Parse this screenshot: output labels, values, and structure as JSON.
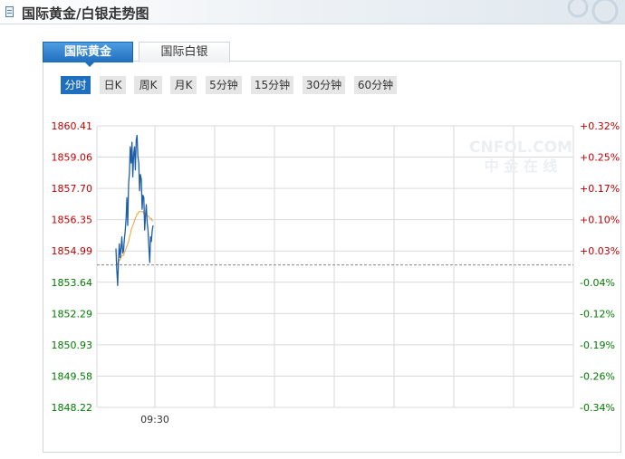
{
  "header": {
    "title": "国际黄金/白银走势图"
  },
  "tabs": [
    {
      "label": "国际黄金",
      "active": true
    },
    {
      "label": "国际白银",
      "active": false
    }
  ],
  "periods": [
    {
      "label": "分时",
      "active": true
    },
    {
      "label": "日K",
      "active": false
    },
    {
      "label": "周K",
      "active": false
    },
    {
      "label": "月K",
      "active": false
    },
    {
      "label": "5分钟",
      "active": false
    },
    {
      "label": "15分钟",
      "active": false
    },
    {
      "label": "30分钟",
      "active": false
    },
    {
      "label": "60分钟",
      "active": false
    }
  ],
  "watermark": {
    "main": "CNFOL.COM",
    "sub": "中 金 在 线"
  },
  "colors": {
    "price_line": "#1f5fa8",
    "avg_line": "#f0a030",
    "up_text": "#c00000",
    "down_text": "#007a00",
    "grid": "#d9d9d9",
    "active_tab": "#1f6fc0"
  },
  "chart_data": {
    "type": "line",
    "title": "",
    "xlabel": "",
    "ylabel": "",
    "ylim": [
      1848.22,
      1860.41
    ],
    "reference_price": 1854.39,
    "x_ticks": [
      "09:30"
    ],
    "y_ticks_left": [
      "1860.41",
      "1859.06",
      "1857.70",
      "1856.35",
      "1854.99",
      "1853.64",
      "1852.29",
      "1850.93",
      "1849.58",
      "1848.22"
    ],
    "y_ticks_right": [
      "+0.32%",
      "+0.25%",
      "+0.17%",
      "+0.10%",
      "+0.03%",
      "-0.04%",
      "-0.12%",
      "-0.19%",
      "-0.26%",
      "-0.34%"
    ],
    "series": [
      {
        "values": [
          1855.1,
          1854.2,
          1853.5,
          1854.6,
          1855.3,
          1854.7,
          1855.1,
          1855.6,
          1854.9,
          1855.0,
          1855.5,
          1855.9,
          1856.4,
          1857.3,
          1856.1,
          1857.9,
          1858.4,
          1859.5,
          1858.8,
          1859.7,
          1858.2,
          1859.2,
          1859.5,
          1858.5,
          1859.8,
          1860.0,
          1859.1,
          1858.8,
          1857.6,
          1858.3,
          1858.1,
          1856.8,
          1857.4,
          1857.3,
          1855.9,
          1856.5,
          1857.0,
          1856.2,
          1855.9,
          1855.2,
          1854.5,
          1855.6,
          1855.4,
          1855.9,
          1856.1
        ]
      },
      {
        "values": [
          1854.6,
          1854.5,
          1854.4,
          1854.5,
          1854.6,
          1854.6,
          1854.7,
          1854.8,
          1854.8,
          1854.8,
          1854.9,
          1855.0,
          1855.1,
          1855.2,
          1855.3,
          1855.4,
          1855.6,
          1855.7,
          1855.9,
          1856.0,
          1856.1,
          1856.2,
          1856.3,
          1856.4,
          1856.5,
          1856.6,
          1856.6,
          1856.7,
          1856.7,
          1856.7,
          1856.7,
          1856.7,
          1856.7,
          1856.6,
          1856.6,
          1856.6,
          1856.6,
          1856.5,
          1856.5,
          1856.5,
          1856.4,
          1856.4,
          1856.4,
          1856.3,
          1856.3
        ]
      }
    ]
  }
}
